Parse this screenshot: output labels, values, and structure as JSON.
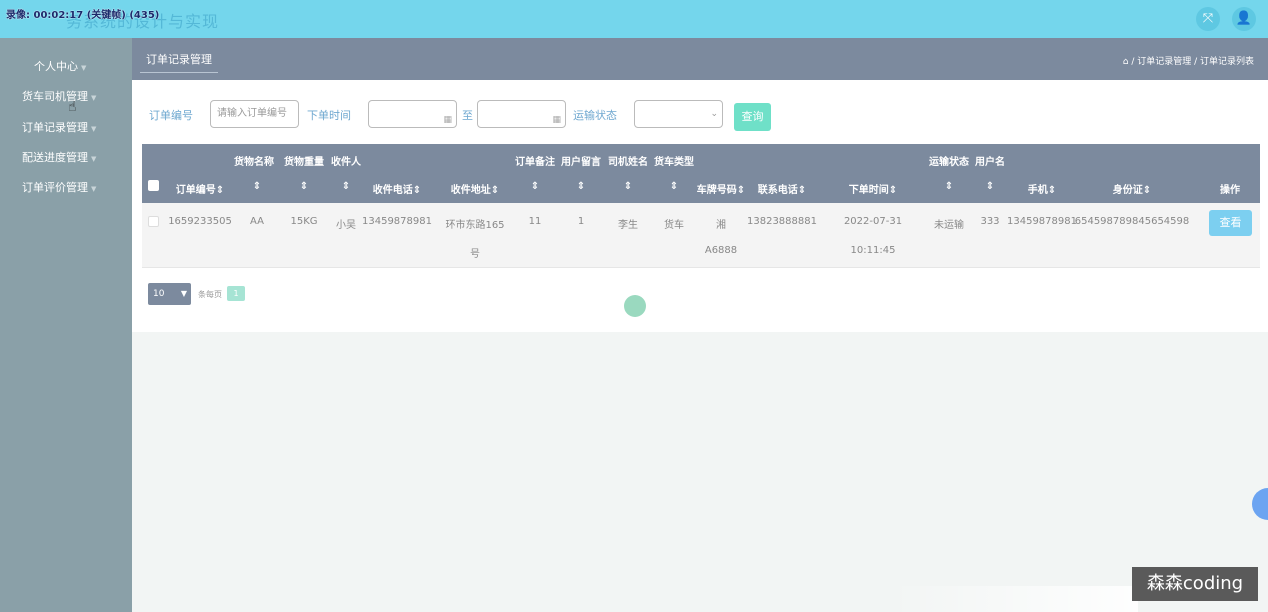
{
  "recording": "录像: 00:02:17 (关键帧) (435)",
  "app_title": "务系统的设计与实现",
  "topbar": {
    "fullscreen_icon": "fullscreen-icon",
    "user_icon": "user-icon"
  },
  "sidebar": {
    "items": [
      {
        "label": "个人中心"
      },
      {
        "label": "货车司机管理"
      },
      {
        "label": "订单记录管理"
      },
      {
        "label": "配送进度管理"
      },
      {
        "label": "订单评价管理"
      }
    ]
  },
  "header": {
    "tab": "订单记录管理",
    "breadcrumb": "/ 订单记录管理 / 订单记录列表"
  },
  "search": {
    "order_no_label": "订单编号",
    "order_no_placeholder": "请输入订单编号",
    "time_label": "下单时间",
    "to": "至",
    "status_label": "运输状态",
    "query_button": "查询"
  },
  "table": {
    "top_headers": {
      "c2": "货物名称",
      "c3": "货物重量",
      "c4": "收件人",
      "c9": "订单备注",
      "c10": "用户留言",
      "c11": "司机姓名",
      "c12": "货车类型",
      "c17": "运输状态",
      "c18": "用户名"
    },
    "columns": {
      "c1": "订单编号",
      "c5": "收件电话",
      "c6": "收件地址",
      "c13": "车牌号码",
      "c14": "联系电话",
      "c15": "下单时间",
      "c19": "手机",
      "c20": "身份证",
      "c21": "操作"
    },
    "row": {
      "order_no": "1659233505",
      "goods": "AA",
      "weight": "15KG",
      "recipient": "小吴",
      "phone": "13459878981",
      "address_1": "环市东路165",
      "address_2": "号",
      "remark": "11",
      "message": "1",
      "driver": "李生",
      "truck_type": "货车",
      "plate_1": "湘",
      "plate_2": "A6888",
      "contact": "13823888881",
      "date": "2022-07-31",
      "time": "10:11:45",
      "status": "未运输",
      "username": "333",
      "mobile": "13459878981",
      "id_card": "654598789845654598",
      "view_button": "查看"
    }
  },
  "pagination": {
    "page_size": "10",
    "per_page_label": "条每页",
    "current_page": "1"
  },
  "watermark": "森森coding"
}
